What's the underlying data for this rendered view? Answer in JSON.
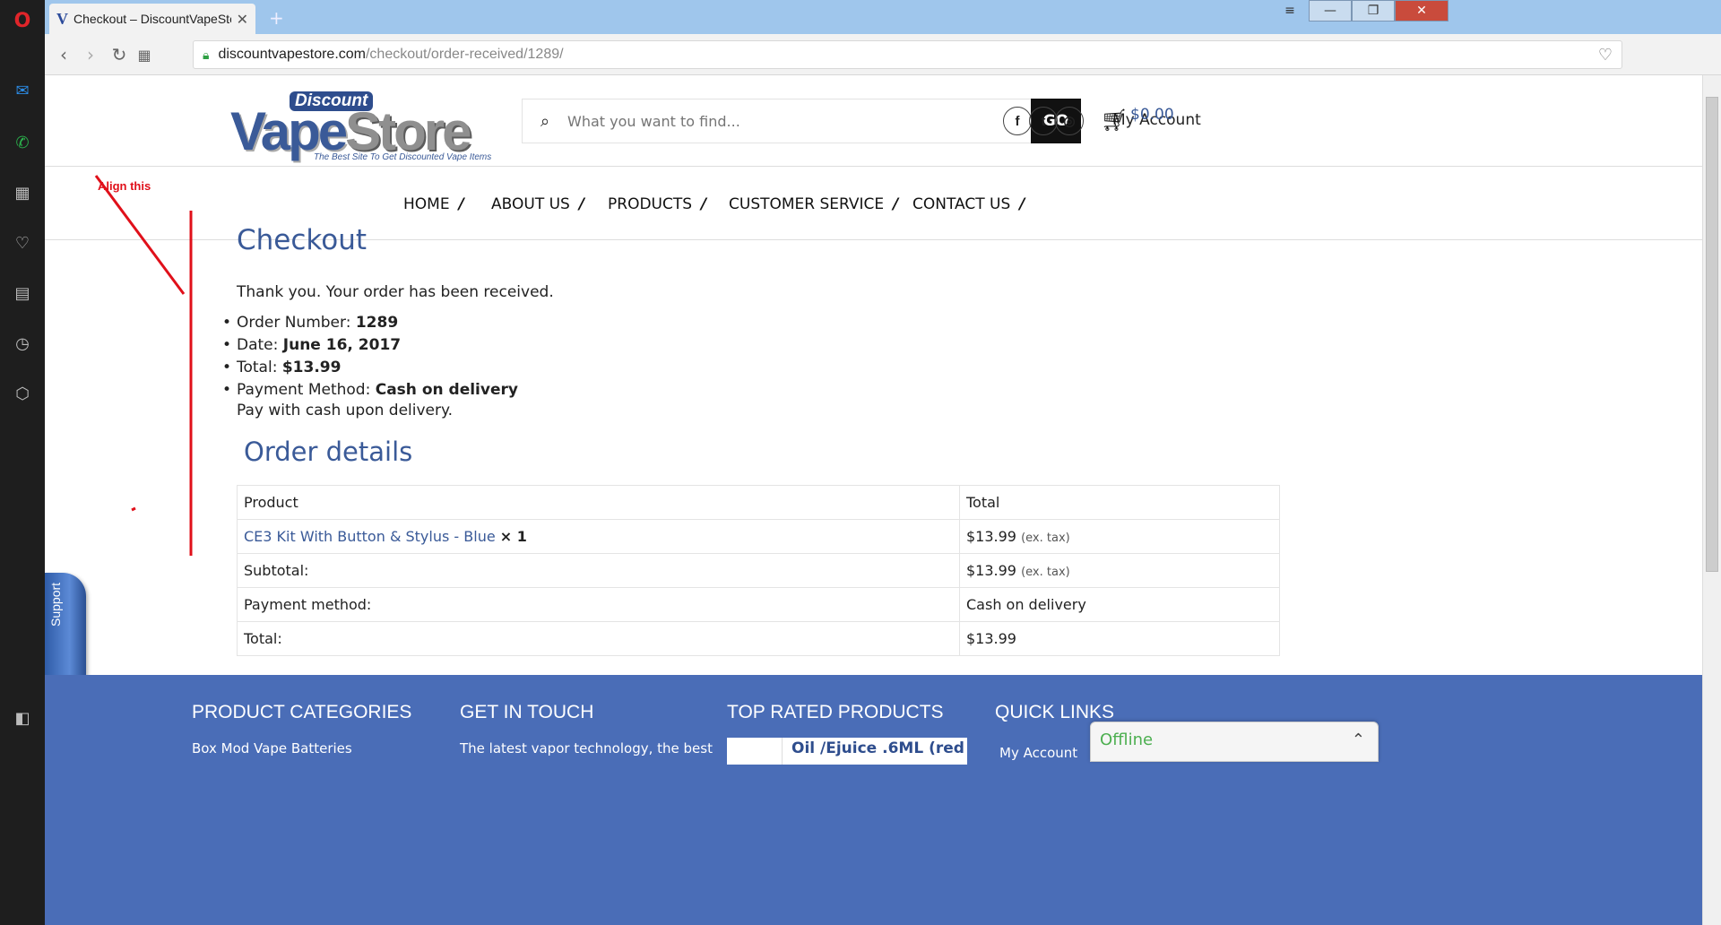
{
  "browser": {
    "tab_title": "Checkout – DiscountVapeStore",
    "tab_favicon": "V",
    "url_host": "discountvapestore.com",
    "url_path": "/checkout/order-received/1289/"
  },
  "site": {
    "logo_top": "Discount",
    "logo_main_a": "Vape",
    "logo_main_b": "Store",
    "logo_tagline": "The Best Site To Get Discounted Vape Items",
    "search_placeholder": "What you want to find...",
    "search_button": "GO",
    "my_account": "My Account",
    "social": [
      "f",
      "t",
      "◎"
    ],
    "cart_total": "$0.00",
    "nav": [
      "HOME",
      "ABOUT US",
      "PRODUCTS",
      "CUSTOMER SERVICE",
      "CONTACT US"
    ],
    "nav_separator": "/"
  },
  "annotation": {
    "text": "Align this"
  },
  "checkout": {
    "title": "Checkout",
    "thank_you": "Thank you. Your order has been received.",
    "order_number_label": "Order Number:",
    "order_number": "1289",
    "date_label": "Date:",
    "date": "June 16, 2017",
    "total_label": "Total:",
    "total": "$13.99",
    "payment_label": "Payment Method:",
    "payment": "Cash on delivery",
    "pay_note": "Pay with cash upon delivery."
  },
  "order_details": {
    "title": "Order details",
    "header_product": "Product",
    "header_total": "Total",
    "item_name": "CE3 Kit With Button & Stylus - Blue",
    "item_qty": "× 1",
    "item_total": "$13.99",
    "ex_tax": "(ex. tax)",
    "subtotal_label": "Subtotal:",
    "subtotal": "$13.99",
    "payment_method_label": "Payment method:",
    "payment_method": "Cash on delivery",
    "total_label": "Total:",
    "total": "$13.99"
  },
  "support": {
    "label": "Support"
  },
  "footer": {
    "col1_title": "PRODUCT CATEGORIES",
    "col1_text": "Box Mod Vape Batteries",
    "col2_title": "GET IN TOUCH",
    "col2_text": "The latest vapor technology, the best",
    "col3_title": "TOP RATED PRODUCTS",
    "col3_product": "Oil /Ejuice .6ML (red",
    "col4_title": "QUICK LINKS",
    "col4_text": "My Account"
  },
  "chat": {
    "status": "Offline"
  },
  "colors": {
    "brand_blue": "#3a5a98",
    "footer_blue": "#4a6db7",
    "annotation_red": "#e0101a"
  }
}
